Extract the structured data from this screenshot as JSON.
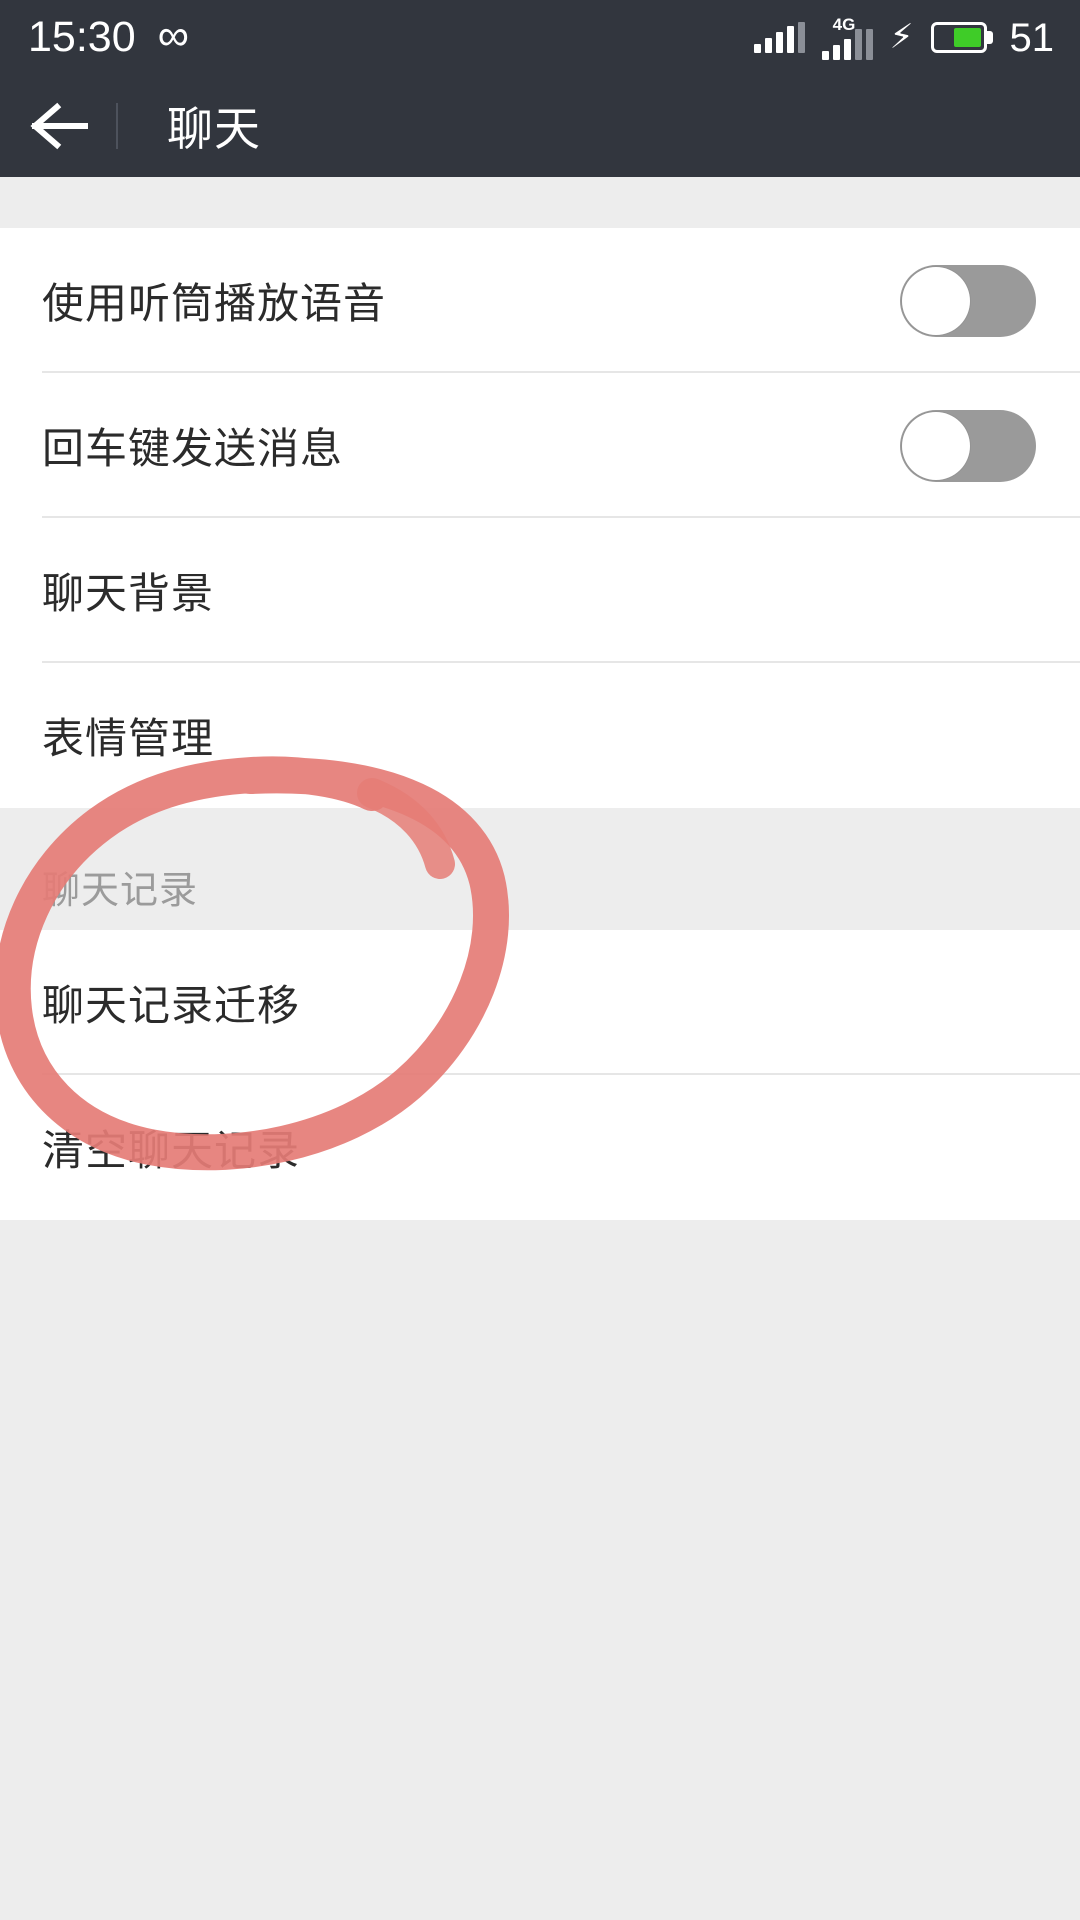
{
  "status_bar": {
    "time": "15:30",
    "infinity_glyph": "∞",
    "network_label": "4G",
    "charging_glyph": "⚡",
    "battery_percent": "51"
  },
  "header": {
    "title": "聊天",
    "back_label": "←"
  },
  "sections": [
    {
      "header": "",
      "rows": [
        {
          "label": "使用听筒播放语音",
          "control": "toggle",
          "toggle_on": false
        },
        {
          "label": "回车键发送消息",
          "control": "toggle",
          "toggle_on": false
        },
        {
          "label": "聊天背景",
          "control": "none"
        },
        {
          "label": "表情管理",
          "control": "none"
        }
      ]
    },
    {
      "header": "聊天记录",
      "rows": [
        {
          "label": "聊天记录迁移",
          "control": "none",
          "annotated": true
        },
        {
          "label": "清空聊天记录",
          "control": "none"
        }
      ]
    }
  ],
  "annotation": {
    "kind": "hand-drawn-ellipse",
    "color": "#e57c76",
    "target_label": "聊天记录迁移"
  },
  "colors": {
    "status_bar_bg": "#32363e",
    "app_bar_bg": "#32363e",
    "page_bg": "#ededed",
    "card_bg": "#ffffff",
    "row_text": "#2b2b2b",
    "section_header_text": "#9b9b9b",
    "divider": "#e6e6e6",
    "toggle_off": "#9a9a9a",
    "battery_fill": "#3fcc28",
    "annotation": "#e57c76"
  }
}
